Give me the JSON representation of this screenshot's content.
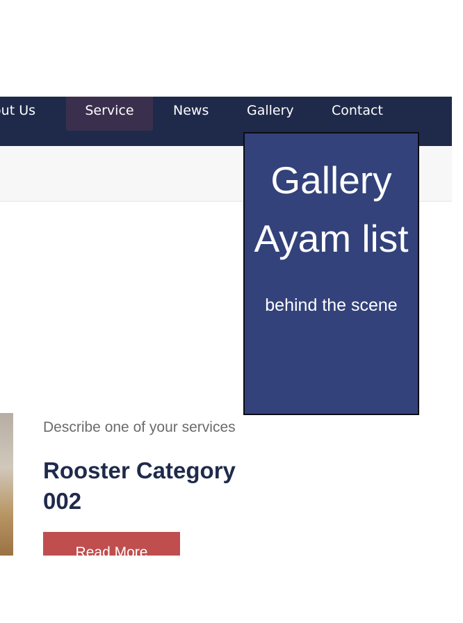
{
  "nav": {
    "items": [
      {
        "label": "bout Us"
      },
      {
        "label": "Service"
      },
      {
        "label": "News"
      },
      {
        "label": "Gallery"
      },
      {
        "label": "Contact"
      }
    ],
    "active": "Service"
  },
  "dropdown": {
    "title": "Gallery",
    "subtitle": "Ayam list",
    "caption": "behind the scene"
  },
  "service": {
    "description": "Describe one of your services",
    "title": "Rooster Category 002",
    "button_label": "Read More"
  },
  "colors": {
    "nav_background": "#1f2a4b",
    "nav_active": "#3b2f4e",
    "dropdown_background": "#33427a",
    "title_text": "#1f2a4b",
    "button": "#c04e4e"
  }
}
